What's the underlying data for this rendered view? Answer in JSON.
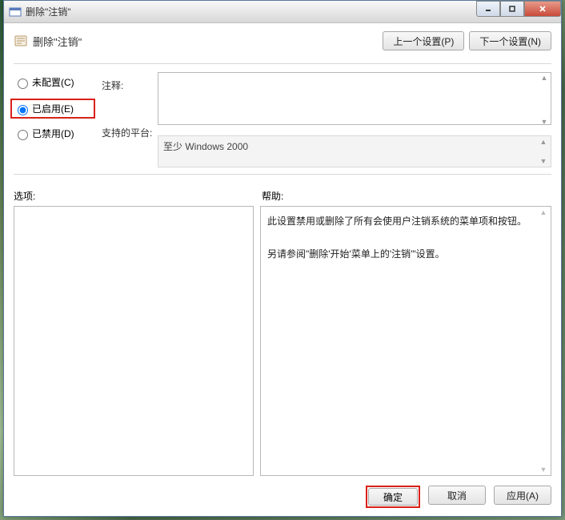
{
  "window": {
    "title": "删除\"注销\""
  },
  "header": {
    "policy_name": "删除\"注销\"",
    "prev_button": "上一个设置(P)",
    "next_button": "下一个设置(N)"
  },
  "radios": {
    "not_configured": "未配置(C)",
    "enabled": "已启用(E)",
    "disabled": "已禁用(D)",
    "selected": "enabled"
  },
  "labels": {
    "comment": "注释:",
    "supported": "支持的平台:",
    "options": "选项:",
    "help": "帮助:"
  },
  "fields": {
    "comment_value": "",
    "supported_value": "至少 Windows 2000"
  },
  "help": {
    "line1": "此设置禁用或删除了所有会使用户注销系统的菜单项和按钮。",
    "line2": "另请参阅\"删除'开始'菜单上的'注销'\"设置。"
  },
  "footer": {
    "ok": "确定",
    "cancel": "取消",
    "apply": "应用(A)"
  }
}
